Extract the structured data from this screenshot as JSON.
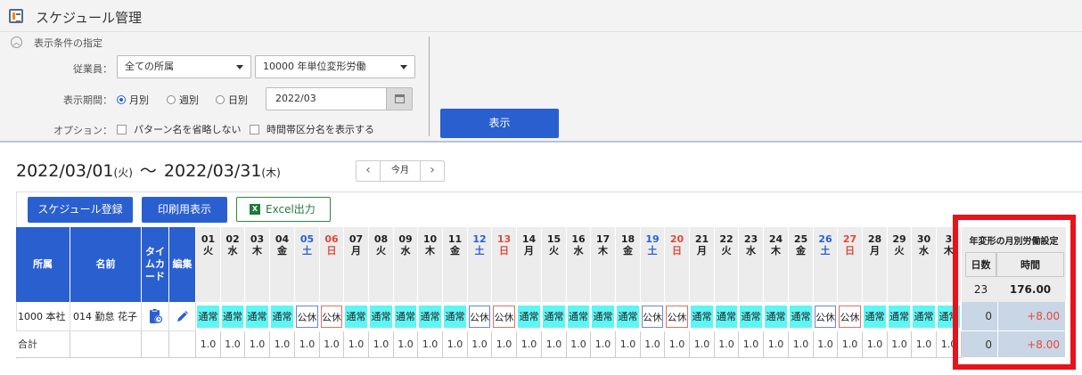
{
  "app": {
    "title": "スケジュール管理"
  },
  "filter": {
    "heading": "表示条件の指定",
    "employee_label": "従業員：",
    "affiliation_select": "全ての所属",
    "pattern_select": "10000 年単位変形労働",
    "period_label": "表示期間：",
    "period_options": [
      "月別",
      "週別",
      "日別"
    ],
    "period_selected": "月別",
    "date_value": "2022/03",
    "option_label": "オプション：",
    "option_1": "パターン名を省略しない",
    "option_2": "時間帯区分名を表示する",
    "show_button": "表示"
  },
  "range": {
    "start": "2022/03/01",
    "start_dow": "(火)",
    "tilde": "〜",
    "end": "2022/03/31",
    "end_dow": "(木)"
  },
  "pager": {
    "prev": "‹",
    "today": "今月",
    "next": "›"
  },
  "toolbar": {
    "register": "スケジュール登録",
    "print": "印刷用表示",
    "excel": "Excel出力",
    "excel_icon": "X"
  },
  "table": {
    "headers": {
      "dept": "所属",
      "name": "名前",
      "timecard": "タイムカード",
      "edit": "編集"
    },
    "days": [
      {
        "d": "01",
        "w": "火"
      },
      {
        "d": "02",
        "w": "水"
      },
      {
        "d": "03",
        "w": "木"
      },
      {
        "d": "04",
        "w": "金"
      },
      {
        "d": "05",
        "w": "土"
      },
      {
        "d": "06",
        "w": "日"
      },
      {
        "d": "07",
        "w": "月"
      },
      {
        "d": "08",
        "w": "火"
      },
      {
        "d": "09",
        "w": "水"
      },
      {
        "d": "10",
        "w": "木"
      },
      {
        "d": "11",
        "w": "金"
      },
      {
        "d": "12",
        "w": "土"
      },
      {
        "d": "13",
        "w": "日"
      },
      {
        "d": "14",
        "w": "月"
      },
      {
        "d": "15",
        "w": "火"
      },
      {
        "d": "16",
        "w": "水"
      },
      {
        "d": "17",
        "w": "木"
      },
      {
        "d": "18",
        "w": "金"
      },
      {
        "d": "19",
        "w": "土"
      },
      {
        "d": "20",
        "w": "日"
      },
      {
        "d": "21",
        "w": "月"
      },
      {
        "d": "22",
        "w": "火"
      },
      {
        "d": "23",
        "w": "水"
      },
      {
        "d": "24",
        "w": "木"
      },
      {
        "d": "25",
        "w": "金"
      },
      {
        "d": "26",
        "w": "土"
      },
      {
        "d": "27",
        "w": "日"
      },
      {
        "d": "28",
        "w": "月"
      },
      {
        "d": "29",
        "w": "火"
      },
      {
        "d": "30",
        "w": "水"
      },
      {
        "d": "3",
        "w": "木"
      }
    ],
    "row": {
      "dept": "1000 本社",
      "name": "014 勤怠 花子",
      "cells": [
        "通常",
        "通常",
        "通常",
        "通常",
        "公休",
        "公休",
        "通常",
        "通常",
        "通常",
        "通常",
        "通常",
        "公休",
        "公休",
        "通常",
        "通常",
        "通常",
        "通常",
        "通常",
        "公休",
        "公休",
        "通常",
        "通常",
        "通常",
        "通常",
        "通常",
        "公休",
        "公休",
        "通常",
        "通常",
        "通常",
        "通常"
      ]
    },
    "total_label": "合計",
    "total_value": "1.0",
    "colors": {
      "header": "#2a5fd0",
      "work": "#5ff5f5",
      "sat": "#2a5fd0",
      "sun": "#e04a3a"
    }
  },
  "summary": {
    "title": "年変形の月別労働設定",
    "days_header": "日数",
    "hours_header": "時間",
    "days_setting": "23",
    "hours_setting": "176.00",
    "row_days": "0",
    "row_hours": "+8.00",
    "total_days": "0",
    "total_hours": "+8.00"
  }
}
